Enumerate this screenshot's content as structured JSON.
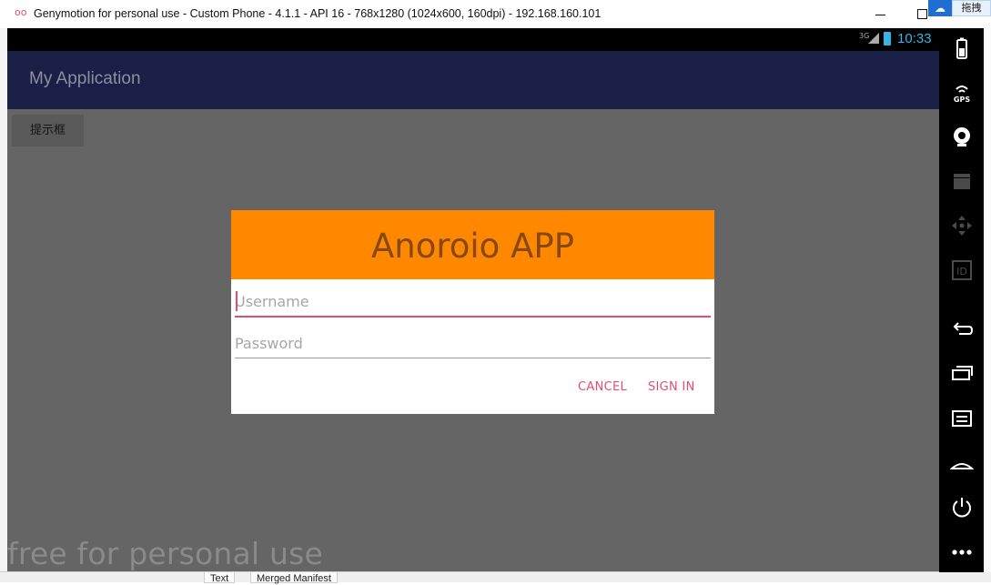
{
  "window": {
    "title": "Genymotion for personal use - Custom Phone - 4.1.1 - API 16 - 768x1280 (1024x600, 160dpi) - 192.168.160.101",
    "app_icon": "oo",
    "drag_label": "拖拽"
  },
  "ide": {
    "tabs": [
      "Text",
      "Merged Manifest"
    ]
  },
  "statusbar": {
    "network": "3G",
    "time": "10:33"
  },
  "app": {
    "title": "My Application",
    "hint_button": "提示框",
    "watermark": "free for personal use"
  },
  "dialog": {
    "title": "Anoroio APP",
    "username_placeholder": "Username",
    "password_placeholder": "Password",
    "cancel_label": "CANCEL",
    "signin_label": "SIGN IN"
  },
  "colors": {
    "actionbar": "#1a1f45",
    "dialog_header": "#ff8800",
    "accent": "#e24d78",
    "clock": "#33b5e5"
  },
  "sidepanel": {
    "tools": [
      "battery-icon",
      "gps-icon",
      "webcam-icon",
      "screencast-icon",
      "dpad-icon",
      "device-id-icon",
      "back-icon",
      "recent-apps-icon",
      "menu-icon",
      "home-icon",
      "power-icon",
      "more-icon"
    ]
  }
}
